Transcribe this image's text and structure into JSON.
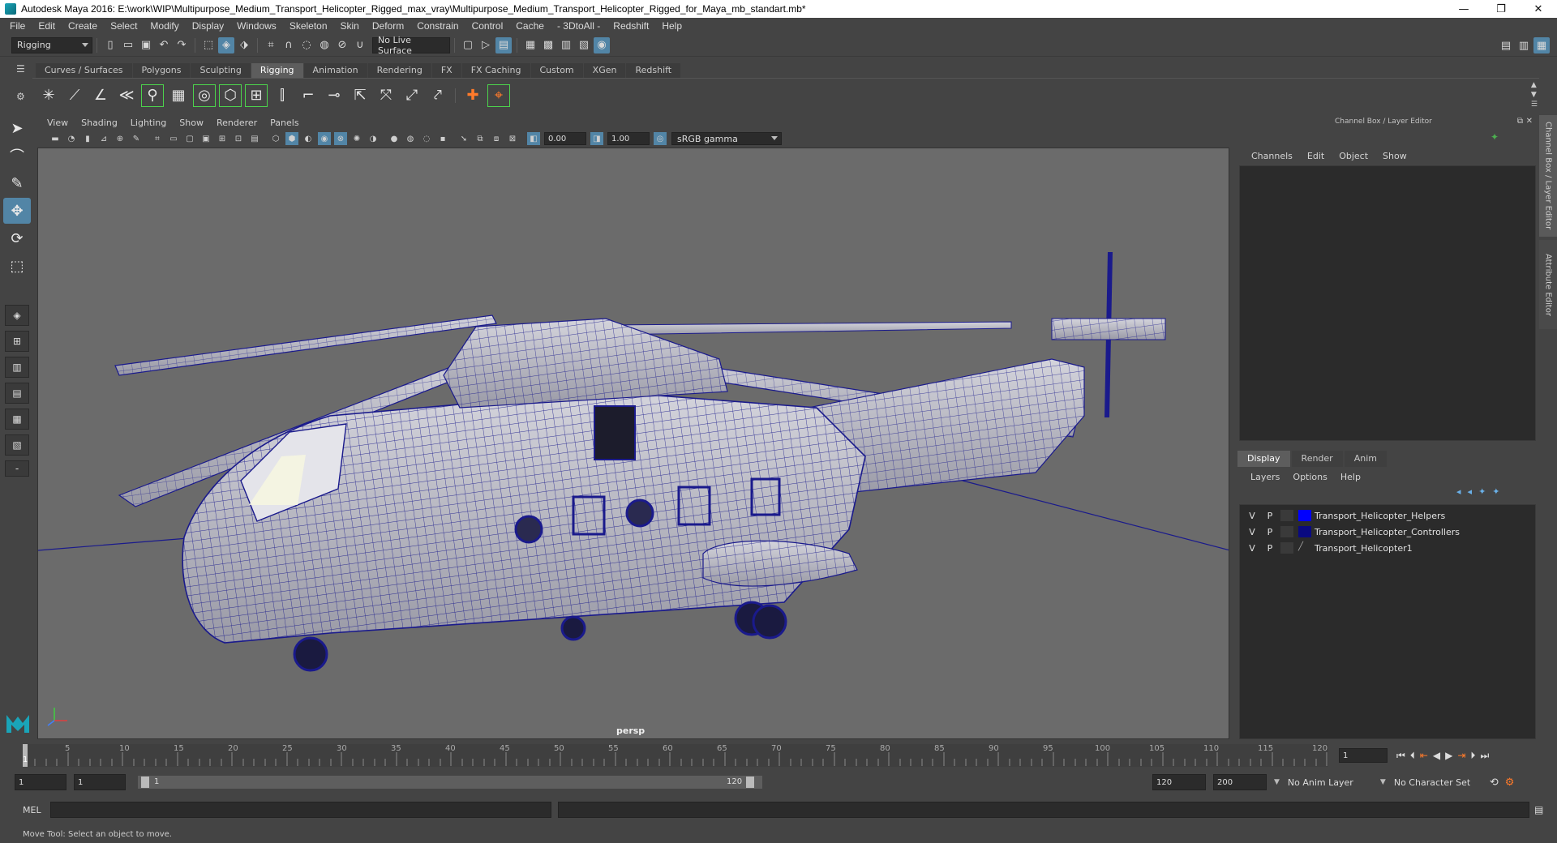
{
  "titlebar": {
    "title": "Autodesk Maya 2016: E:\\work\\WIP\\Multipurpose_Medium_Transport_Helicopter_Rigged_max_vray\\Multipurpose_Medium_Transport_Helicopter_Rigged_for_Maya_mb_standart.mb*",
    "minimize": "—",
    "maximize": "❐",
    "close": "✕"
  },
  "menus": [
    "File",
    "Edit",
    "Create",
    "Select",
    "Modify",
    "Display",
    "Windows",
    "Skeleton",
    "Skin",
    "Deform",
    "Constrain",
    "Control",
    "Cache",
    "- 3DtoAll -",
    "Redshift",
    "Help"
  ],
  "statusline": {
    "mode": "Rigging",
    "live_surface": "No Live Surface"
  },
  "shelf_tabs": [
    {
      "label": "Curves / Surfaces",
      "active": false
    },
    {
      "label": "Polygons",
      "active": false
    },
    {
      "label": "Sculpting",
      "active": false
    },
    {
      "label": "Rigging",
      "active": true
    },
    {
      "label": "Animation",
      "active": false
    },
    {
      "label": "Rendering",
      "active": false
    },
    {
      "label": "FX",
      "active": false
    },
    {
      "label": "FX Caching",
      "active": false
    },
    {
      "label": "Custom",
      "active": false
    },
    {
      "label": "XGen",
      "active": false
    },
    {
      "label": "Redshift",
      "active": false
    }
  ],
  "viewport": {
    "menus": [
      "View",
      "Shading",
      "Lighting",
      "Show",
      "Renderer",
      "Panels"
    ],
    "exposure": "0.00",
    "gamma": "1.00",
    "color_space": "sRGB gamma",
    "camera_label": "persp",
    "wire_color": "#1a1a8c",
    "bg_color": "#6b6b6b"
  },
  "channel_box": {
    "header": "Channel Box / Layer Editor",
    "menus": [
      "Channels",
      "Edit",
      "Object",
      "Show"
    ]
  },
  "layer_editor": {
    "tabs": [
      {
        "label": "Display",
        "active": true
      },
      {
        "label": "Render",
        "active": false
      },
      {
        "label": "Anim",
        "active": false
      }
    ],
    "menus": [
      "Layers",
      "Options",
      "Help"
    ],
    "layers": [
      {
        "v": "V",
        "p": "P",
        "name": "Transport_Helicopter_Helpers",
        "color": "#0000ff"
      },
      {
        "v": "V",
        "p": "P",
        "name": "Transport_Helicopter_Controllers",
        "color": "#0a0a80"
      },
      {
        "v": "V",
        "p": "P",
        "name": "Transport_Helicopter1",
        "color": ""
      }
    ]
  },
  "side_tabs": [
    "Channel Box / Layer Editor",
    "Attribute Editor"
  ],
  "timeline": {
    "ticks": [
      "5",
      "10",
      "15",
      "20",
      "25",
      "30",
      "35",
      "40",
      "45",
      "50",
      "55",
      "60",
      "65",
      "70",
      "75",
      "80",
      "85",
      "90",
      "95",
      "100",
      "105",
      "110",
      "115",
      "120"
    ],
    "start_tick": "1",
    "current_frame": "1"
  },
  "range": {
    "start": "1",
    "anim_start": "1",
    "slider_start": "1",
    "slider_end": "120",
    "end": "120",
    "anim_end": "200",
    "anim_layer": "No Anim Layer",
    "character_set": "No Character Set"
  },
  "cmdline": {
    "label": "MEL"
  },
  "helpline": {
    "text": "Move Tool: Select an object to move."
  }
}
